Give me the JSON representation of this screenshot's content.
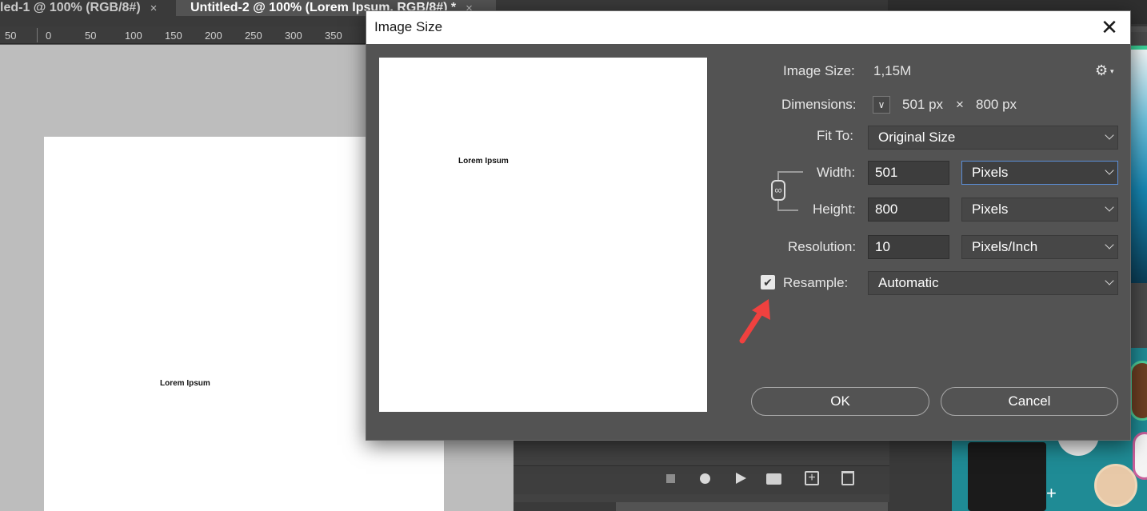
{
  "tabs": [
    {
      "label": "led-1 @ 100% (RGB/8#)",
      "close": "×"
    },
    {
      "label": "Untitled-2 @ 100% (Lorem Ipsum, RGB/8#) *",
      "close": "×"
    }
  ],
  "ruler": {
    "ticks": [
      "50",
      "0",
      "50",
      "100",
      "150",
      "200",
      "250",
      "300",
      "350"
    ]
  },
  "document": {
    "text": "Lorem Ipsum"
  },
  "dialog": {
    "title": "Image Size",
    "close": "✕",
    "preview_text": "Lorem Ipsum",
    "image_size_label": "Image Size:",
    "image_size_value": "1,15M",
    "dimensions_label": "Dimensions:",
    "dimensions_width": "501 px",
    "dimensions_times": "×",
    "dimensions_height": "800 px",
    "fit_to_label": "Fit To:",
    "fit_to_value": "Original Size",
    "width_label": "Width:",
    "width_value": "501",
    "width_unit": "Pixels",
    "height_label": "Height:",
    "height_value": "800",
    "height_unit": "Pixels",
    "resolution_label": "Resolution:",
    "resolution_value": "10",
    "resolution_unit": "Pixels/Inch",
    "resample_label": "Resample:",
    "resample_checked": true,
    "resample_value": "Automatic",
    "ok_label": "OK",
    "cancel_label": "Cancel"
  },
  "colors": {
    "dialog_bg": "#535353",
    "field_focus": "#5b8dd6",
    "arrow": "#f0413f"
  }
}
